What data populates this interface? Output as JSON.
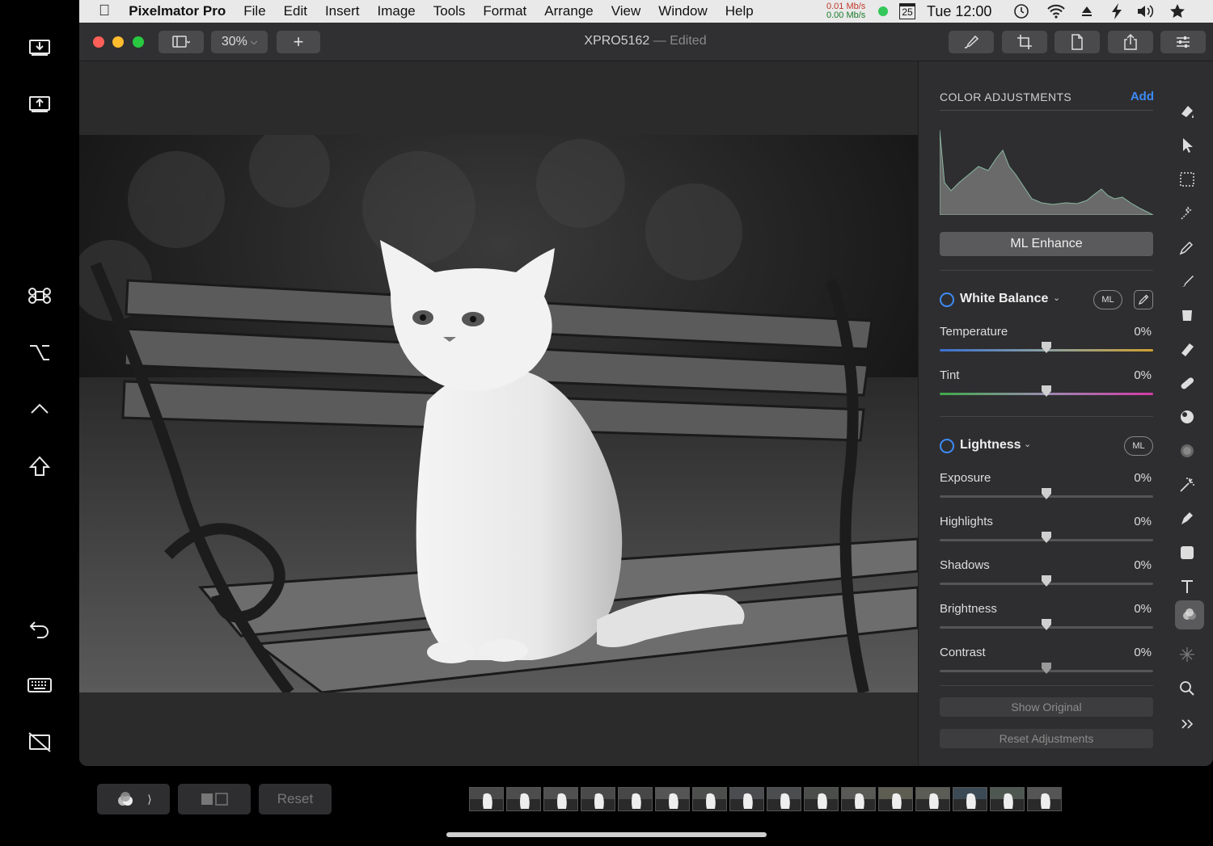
{
  "sidecar": {
    "items": [
      {
        "name": "download-icon"
      },
      {
        "name": "upload-icon"
      },
      {
        "name": "command-key-icon"
      },
      {
        "name": "option-key-icon"
      },
      {
        "name": "control-key-icon"
      },
      {
        "name": "shift-key-icon"
      },
      {
        "name": "undo-icon"
      },
      {
        "name": "keyboard-icon"
      },
      {
        "name": "hide-sidebar-icon"
      }
    ]
  },
  "menubar": {
    "app": "Pixelmator Pro",
    "items": [
      "File",
      "Edit",
      "Insert",
      "Image",
      "Tools",
      "Format",
      "Arrange",
      "View",
      "Window",
      "Help"
    ],
    "net_up": "0.01 Mb/s",
    "net_down": "0.00 Mb/s",
    "calendar_day": "25",
    "clock": "Tue 12:00"
  },
  "titlebar": {
    "zoom": "30%",
    "add_label": "+",
    "doc_name": "XPRO5162",
    "doc_status": "— Edited"
  },
  "panel": {
    "section_title": "COLOR ADJUSTMENTS",
    "add_label": "Add",
    "ml_enhance": "ML Enhance",
    "white_balance": {
      "title": "White Balance",
      "ml": "ML",
      "rows": [
        {
          "label": "Temperature",
          "value": "0%"
        },
        {
          "label": "Tint",
          "value": "0%"
        }
      ]
    },
    "lightness": {
      "title": "Lightness",
      "ml": "ML",
      "rows": [
        {
          "label": "Exposure",
          "value": "0%"
        },
        {
          "label": "Highlights",
          "value": "0%"
        },
        {
          "label": "Shadows",
          "value": "0%"
        },
        {
          "label": "Brightness",
          "value": "0%"
        },
        {
          "label": "Contrast",
          "value": "0%"
        }
      ]
    },
    "show_original": "Show Original",
    "reset_adjustments": "Reset Adjustments"
  },
  "bottombar": {
    "reset": "Reset",
    "thumb_count": 16
  },
  "colors": {
    "accent": "#3d8bf5",
    "close": "#ff5f57",
    "minimize": "#febc2e",
    "zoom": "#28c840"
  }
}
